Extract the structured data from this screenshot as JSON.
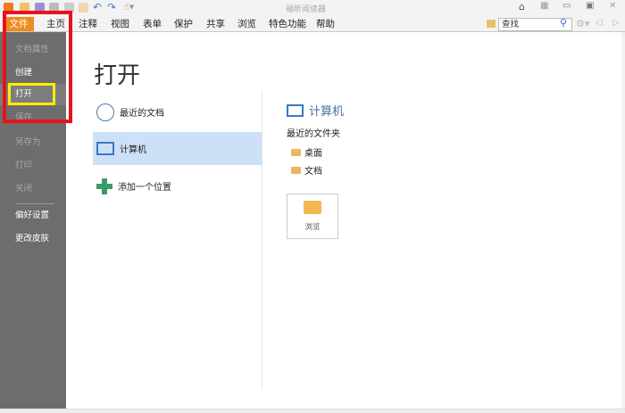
{
  "window": {
    "title": "福昕阅读器"
  },
  "menu": {
    "tabs": [
      "文件",
      "主页",
      "注释",
      "视图",
      "表单",
      "保护",
      "共享",
      "浏览",
      "特色功能",
      "帮助"
    ]
  },
  "search": {
    "placeholder": "查找"
  },
  "sidebar": {
    "items": [
      "文档属性",
      "创建",
      "打开",
      "保存",
      "另存为",
      "打印",
      "关闭",
      "偏好设置",
      "更改皮肤"
    ]
  },
  "main": {
    "title": "打开",
    "locations": [
      "最近的文档",
      "计算机",
      "添加一个位置"
    ],
    "right": {
      "header": "计算机",
      "recent_label": "最近的文件夹",
      "folders": [
        "桌面",
        "文档"
      ],
      "browse": "浏览"
    }
  },
  "colors": {
    "file_tab": "#f08c1e",
    "highlight": "#cde0f7",
    "annotation_red": "#e8121c",
    "annotation_yellow": "#ffee00"
  }
}
